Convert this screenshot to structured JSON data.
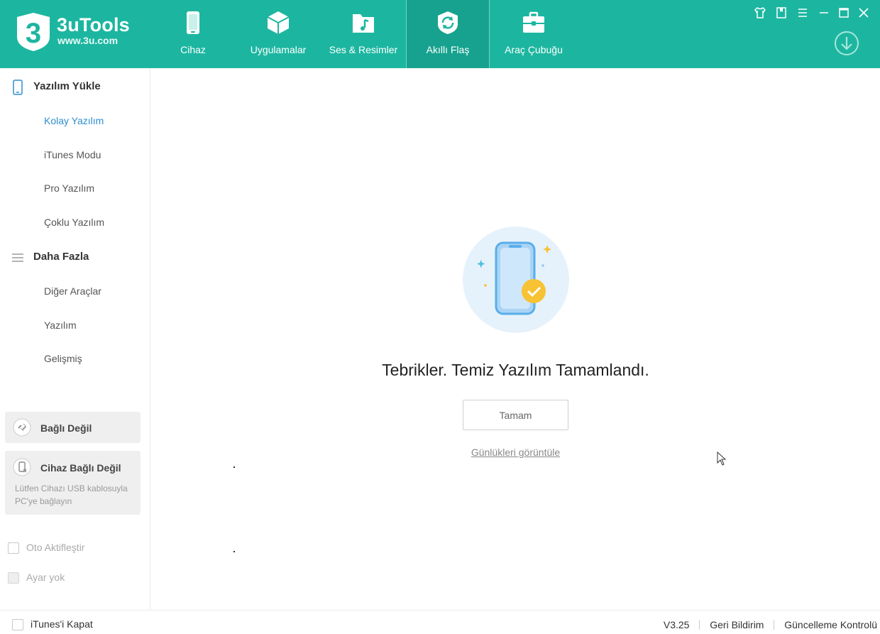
{
  "app": {
    "logo_name": "3uTools",
    "logo_url": "www.3u.com",
    "accent_color": "#1cb6a0"
  },
  "nav": {
    "tabs": [
      {
        "label": "Cihaz",
        "icon": "phone-icon"
      },
      {
        "label": "Uygulamalar",
        "icon": "apps-box-icon"
      },
      {
        "label": "Ses & Resimler",
        "icon": "media-folder-icon"
      },
      {
        "label": "Akıllı Flaş",
        "icon": "flash-refresh-icon",
        "active": true
      },
      {
        "label": "Araç Çubuğu",
        "icon": "toolbox-icon"
      }
    ]
  },
  "sidebar": {
    "section1": {
      "label": "Yazılım Yükle",
      "items": [
        "Kolay Yazılım",
        "iTunes Modu",
        "Pro Yazılım",
        "Çoklu Yazılım"
      ]
    },
    "section2": {
      "label": "Daha Fazla",
      "items": [
        "Diğer Araçlar",
        "Yazılım",
        "Gelişmiş"
      ]
    },
    "status": {
      "connection": "Bağlı Değil",
      "device_title": "Cihaz Bağlı Değil",
      "device_desc": "Lütfen Cihazı USB kablosuyla PC'ye bağlayın"
    },
    "options": {
      "auto_activate": "Oto Aktifleştir",
      "no_settings": "Ayar yok"
    }
  },
  "main": {
    "message": "Tebrikler. Temiz Yazılım Tamamlandı.",
    "ok_button": "Tamam",
    "log_link": "Günlükleri görüntüle"
  },
  "footer": {
    "close_itunes": "iTunes'i Kapat",
    "version": "V3.25",
    "feedback": "Geri Bildirim",
    "update_check": "Güncelleme Kontrolü"
  }
}
